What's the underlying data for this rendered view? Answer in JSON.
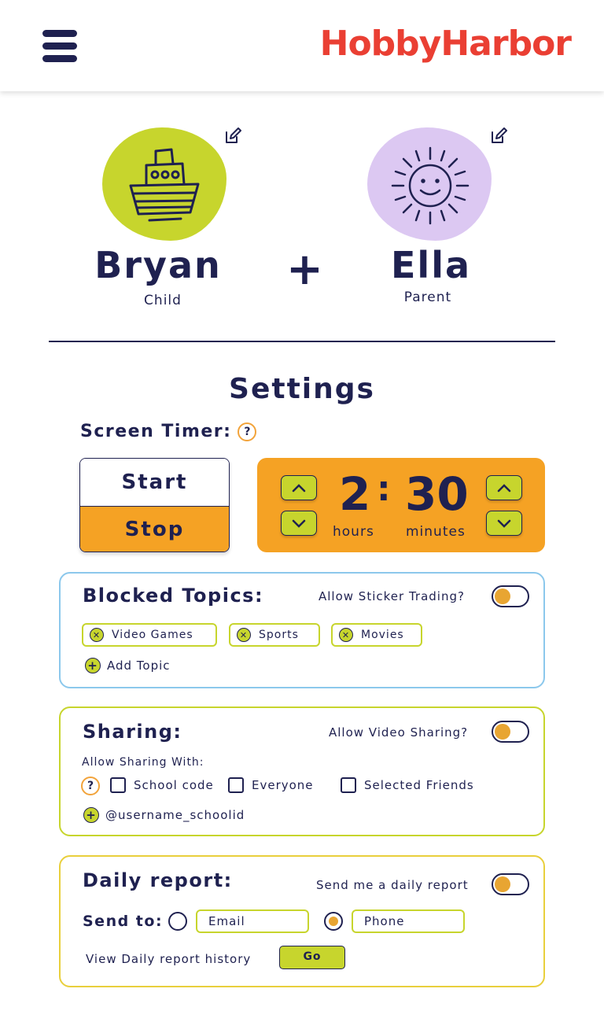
{
  "header": {
    "brand": "HobbyHarbor",
    "menu_icon": "hamburger-menu-icon",
    "brand_color": "#ea3f33"
  },
  "profiles": {
    "child": {
      "name": "Bryan",
      "role": "Child",
      "avatar_icon": "boat-icon",
      "avatar_color": "#c7d52d"
    },
    "parent": {
      "name": "Ella",
      "role": "Parent",
      "avatar_icon": "sun-icon",
      "avatar_color": "#dcc8f2"
    },
    "joiner": "+",
    "edit_icon": "edit-icon"
  },
  "settings": {
    "title": "Settings",
    "screen_timer": {
      "label": "Screen Timer:",
      "help": "?",
      "start_label": "Start",
      "stop_label": "Stop",
      "hours": "2",
      "separator": ":",
      "minutes": "30",
      "hours_label": "hours",
      "minutes_label": "minutes"
    },
    "blocked_topics": {
      "title": "Blocked Topics:",
      "toggle_label": "Allow Sticker Trading?",
      "topics": [
        "Video Games",
        "Sports",
        "Movies"
      ],
      "add_label": "Add Topic"
    },
    "sharing": {
      "title": "Sharing:",
      "toggle_label": "Allow Video Sharing?",
      "allow_with_label": "Allow Sharing With:",
      "help": "?",
      "options": [
        "School code",
        "Everyone",
        "Selected Friends"
      ],
      "add_label": "@username_schoolid"
    },
    "daily_report": {
      "title": "Daily report:",
      "toggle_label": "Send me a daily report",
      "send_to_label": "Send to:",
      "email_label": "Email",
      "phone_label": "Phone",
      "selected": "Phone",
      "history_label": "View Daily report history",
      "go_label": "Go"
    }
  },
  "colors": {
    "navy": "#1f2150",
    "orange": "#f5a224",
    "lime": "#c7d52d",
    "blue_border": "#8cc8ec",
    "yellow_border": "#e9cf3c"
  }
}
